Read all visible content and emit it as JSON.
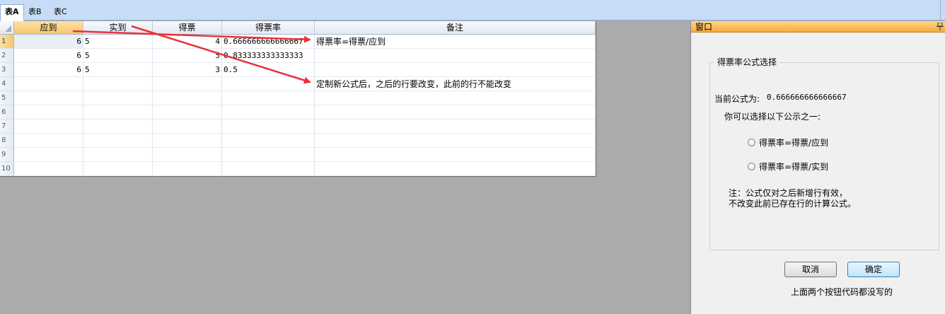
{
  "tabs": [
    {
      "label": "表A",
      "active": true
    },
    {
      "label": "表B",
      "active": false
    },
    {
      "label": "表C",
      "active": false
    }
  ],
  "grid": {
    "columns": [
      "应到",
      "实到",
      "得票",
      "得票率",
      "备注"
    ],
    "selected_column": 0,
    "row_numbers": [
      "1",
      "2",
      "3",
      "4",
      "5",
      "6",
      "7",
      "8",
      "9",
      "10"
    ],
    "rows": [
      [
        "6",
        "5",
        "4",
        "0.666666666666667",
        "得票率=得票/应到"
      ],
      [
        "6",
        "5",
        "5",
        "0.833333333333333",
        ""
      ],
      [
        "6",
        "5",
        "3",
        "0.5",
        ""
      ],
      [
        "",
        "",
        "",
        "",
        "定制新公式后，之后的行要改变，此前的行不能改变"
      ],
      [
        "",
        "",
        "",
        "",
        ""
      ],
      [
        "",
        "",
        "",
        "",
        ""
      ],
      [
        "",
        "",
        "",
        "",
        ""
      ],
      [
        "",
        "",
        "",
        "",
        ""
      ],
      [
        "",
        "",
        "",
        "",
        ""
      ],
      [
        "",
        "",
        "",
        "",
        ""
      ]
    ]
  },
  "window": {
    "title": "窗口",
    "group_title": "得票率公式选择",
    "current_label": "当前公式为:",
    "current_value": "0.666666666666667",
    "choose_prompt": "你可以选择以下公示之一:",
    "options": [
      "得票率=得票/应到",
      "得票率=得票/实到"
    ],
    "note_line1": "注：公式仅对之后新增行有效，",
    "note_line2": "不改变此前已存在行的计算公式。",
    "cancel_label": "取消",
    "ok_label": "确定",
    "footer_note": "上面两个按钮代码都没写的"
  },
  "colors": {
    "arrow": "#e8323a",
    "selected_header": "#f7c56b",
    "tabbar": "#c7dcf6"
  }
}
